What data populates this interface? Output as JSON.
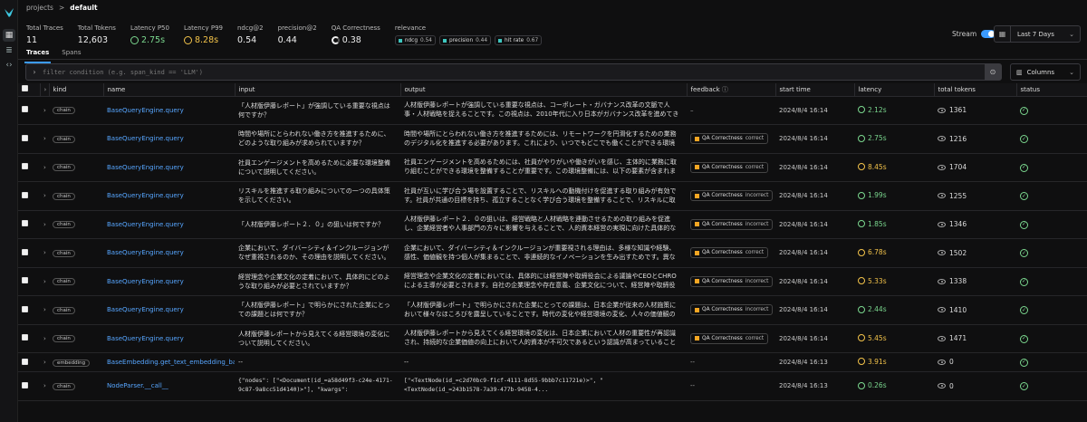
{
  "breadcrumb": {
    "root": "projects",
    "separator": ">",
    "current": "default"
  },
  "metrics": [
    {
      "label": "Total Traces",
      "value": "11",
      "kind": "plain"
    },
    {
      "label": "Total Tokens",
      "value": "12,603",
      "kind": "plain"
    },
    {
      "label": "Latency P50",
      "value": "2.75s",
      "kind": "green"
    },
    {
      "label": "Latency P99",
      "value": "8.28s",
      "kind": "yellow"
    },
    {
      "label": "ndcg@2",
      "value": "0.54",
      "kind": "plain"
    },
    {
      "label": "precision@2",
      "value": "0.44",
      "kind": "plain"
    },
    {
      "label": "QA Correctness",
      "value": "0.38",
      "kind": "donut"
    }
  ],
  "relevance": {
    "label": "relevance",
    "chips": [
      {
        "name": "ndcg",
        "value": "0.54"
      },
      {
        "name": "precision",
        "value": "0.44"
      },
      {
        "name": "hit rate",
        "value": "0.67"
      }
    ]
  },
  "stream_label": "Stream",
  "time_range": "Last 7 Days",
  "tabs": [
    "Traces",
    "Spans"
  ],
  "filter_placeholder": "filter condition (e.g. span_kind == 'LLM')",
  "columns_label": "Columns",
  "headers": {
    "kind": "kind",
    "name": "name",
    "input": "input",
    "output": "output",
    "feedback": "feedback",
    "start_time": "start time",
    "latency": "latency",
    "total_tokens": "total tokens",
    "status": "status"
  },
  "colors": {
    "accent": "#3b9bff",
    "link": "#57a6ff",
    "green": "#7bd88f",
    "yellow": "#f3c34a",
    "feedback": "#f5a623",
    "relevance": "#3ec7c0"
  },
  "rows": [
    {
      "kind": "chain",
      "name": "BaseQueryEngine.query",
      "input": "「人材版伊藤レポート」が強調している重要な視点は何ですか？",
      "output": "人材版伊藤レポートが強調している重要な視点は、コーポレート・ガバナンス改革の文脈で人事・人材戦略を捉えることです。この視点は、2010年代に入り日本がガバナンス改革を進めてきた中で、人事・人材戦...",
      "feedback": null,
      "start_time": "2024/8/4 16:14",
      "latency": "2.12s",
      "lat_color": "green",
      "tokens": "1361"
    },
    {
      "kind": "chain",
      "name": "BaseQueryEngine.query",
      "input": "時間や場所にとらわれない働き方を推進するために、どのような取り組みが求められていますか？",
      "output": "時間や場所にとらわれない働き方を推進するためには、リモートワークを円滑化するための業務のデジタル化を推進する必要があります。これにより、いつでもどこでも働くことができる環境を整備することが重要での...",
      "feedback": {
        "label": "QA Correctness",
        "result": "correct"
      },
      "start_time": "2024/8/4 16:14",
      "latency": "2.75s",
      "lat_color": "green",
      "tokens": "1216"
    },
    {
      "kind": "chain",
      "name": "BaseQueryEngine.query",
      "input": "社員エンゲージメントを高めるために必要な環境整備について説明してください。",
      "output": "社員エンゲージメントを高めるためには、社員がやりがいや働きがいを感じ、主体的に業務に取り組むことができる環境を整備することが重要です。この環境整備には、以下の要素が含まれます。1. 企業の理...",
      "feedback": {
        "label": "QA Correctness",
        "result": "correct"
      },
      "start_time": "2024/8/4 16:14",
      "latency": "8.45s",
      "lat_color": "yellow",
      "tokens": "1704"
    },
    {
      "kind": "chain",
      "name": "BaseQueryEngine.query",
      "input": "リスキルを推進する取り組みについての一つの具体策を示してください。",
      "output": "社員が互いに学び合う場を設置することで、リスキルへの動機付けを促進する取り組みが有効です。社員が共通の目標を持ち、孤立することなく学び合う環境を整備することで、リスキルに取り組む社員の理解を深め...",
      "feedback": {
        "label": "QA Correctness",
        "result": "incorrect"
      },
      "start_time": "2024/8/4 16:14",
      "latency": "1.99s",
      "lat_color": "green",
      "tokens": "1255"
    },
    {
      "kind": "chain",
      "name": "BaseQueryEngine.query",
      "input": "「人材版伊藤レポート２．０」の狙いは何ですか？",
      "output": "人材版伊藤レポート２．０の狙いは、経営戦略と人材戦略を連動させるための取り組みを促進し、企業経営者や人事部門の方々に影響を与えることで、人的資本経営の実現に向けた具体的な方針や施策を提供することで...",
      "feedback": {
        "label": "QA Correctness",
        "result": "incorrect"
      },
      "start_time": "2024/8/4 16:14",
      "latency": "1.85s",
      "lat_color": "green",
      "tokens": "1346"
    },
    {
      "kind": "chain",
      "name": "BaseQueryEngine.query",
      "input": "企業において、ダイバーシティ＆インクルージョンがなぜ重視されるのか、その理由を説明してください。",
      "output": "企業において、ダイバーシティ＆インクルージョンが重要視される理由は、多様な知識や経験、感性、価値観を持つ個人が集まることで、非連続的なイノベーションを生み出すためです。異なるバックグラウンドや視...",
      "feedback": {
        "label": "QA Correctness",
        "result": "correct"
      },
      "start_time": "2024/8/4 16:14",
      "latency": "6.78s",
      "lat_color": "yellow",
      "tokens": "1502"
    },
    {
      "kind": "chain",
      "name": "BaseQueryEngine.query",
      "input": "経営理念や企業文化の定着において、具体的にどのような取り組みが必要とされていますか？",
      "output": "経営理念や企業文化の定着においては、具体的には経営陣や取締役会による議論やCEOとCHROによる主導が必要とされます。自社の企業理念や存在意義、企業文化について、経営陣や取締役会が議論する機会...",
      "feedback": {
        "label": "QA Correctness",
        "result": "incorrect"
      },
      "start_time": "2024/8/4 16:14",
      "latency": "5.33s",
      "lat_color": "yellow",
      "tokens": "1338"
    },
    {
      "kind": "chain",
      "name": "BaseQueryEngine.query",
      "input": "「人材版伊藤レポート」で明らかにされた企業にとっての課題とは何ですか？",
      "output": "「人材版伊藤レポート」で明らかにされた企業にとっての課題は、日本企業が従来の人材施策において様々なほころびを露呈していることです。時代の変化や経営環境の変化、人々の価値観の変化に対応できず、長期...",
      "feedback": {
        "label": "QA Correctness",
        "result": "incorrect"
      },
      "start_time": "2024/8/4 16:14",
      "latency": "2.44s",
      "lat_color": "green",
      "tokens": "1410"
    },
    {
      "kind": "chain",
      "name": "BaseQueryEngine.query",
      "input": "人材版伊藤レポートから見えてくる経営環境の変化について説明してください。",
      "output": "人材版伊藤レポートから見えてくる経営環境の変化は、日本企業において人材の重要性が再認識され、持続的な企業価値の向上において人的資本が不可欠であるという認識が高まっていることが挙げられます。企業の...",
      "feedback": {
        "label": "QA Correctness",
        "result": "correct"
      },
      "start_time": "2024/8/4 16:14",
      "latency": "5.45s",
      "lat_color": "yellow",
      "tokens": "1471"
    },
    {
      "kind": "embedding",
      "name": "BaseEmbedding.get_text_embedding_batch",
      "input": "--",
      "output": "--",
      "feedback": "--",
      "start_time": "2024/8/4 16:13",
      "latency": "3.91s",
      "lat_color": "yellow",
      "tokens": "0",
      "short": true
    },
    {
      "kind": "chain",
      "name": "NodeParser.__call__",
      "input": "{\"nodes\": [\"<Document(id_=a58d49f3-c24e-4171-9c87-9a8cc51d4140)>\"], \"kwargs\": {\"show_progress\": f...",
      "output": "[\"<TextNode(id_=c2d70bc9-f1cf-4111-8d55-9bbb7c11721e)>\", \"<TextNode(id_=243b1578-7a39-477b-9458-4...",
      "feedback": "--",
      "start_time": "2024/8/4 16:13",
      "latency": "0.26s",
      "lat_color": "green",
      "tokens": "0",
      "mono": true
    }
  ]
}
